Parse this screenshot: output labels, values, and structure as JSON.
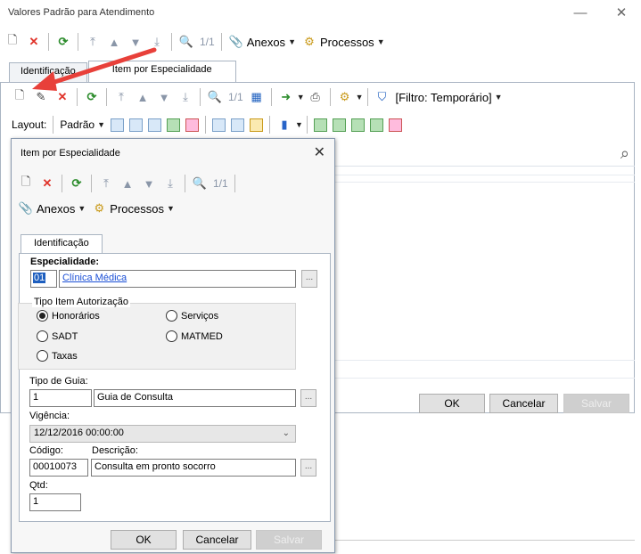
{
  "window": {
    "title": "Valores Padrão para Atendimento",
    "minimize": "—",
    "close": "✕"
  },
  "main_toolbar": {
    "counter": "1/1",
    "anexos": "Anexos",
    "processos": "Processos"
  },
  "main_tabs": [
    {
      "label": "Identificação"
    },
    {
      "label": "Item por Especialidade"
    }
  ],
  "inner_toolbar": {
    "counter": "1/1",
    "filter": "[Filtro: Temporário]"
  },
  "layout_bar": {
    "layout_label": "Layout:",
    "padrao": "Padrão"
  },
  "bg_buttons": {
    "ok": "OK",
    "cancel": "Cancelar",
    "save": "Salvar"
  },
  "dialog": {
    "title": "Item por Especialidade",
    "close": "✕",
    "counter": "1/1",
    "anexos": "Anexos",
    "processos": "Processos",
    "tab": "Identificação",
    "especialidade_label": "Especialidade:",
    "especialidade_code": "01",
    "especialidade_name": "Clínica Médica",
    "group_title": "Tipo Item Autorização",
    "radios": [
      {
        "label": "Honorários",
        "checked": true
      },
      {
        "label": "Serviços",
        "checked": false
      },
      {
        "label": "SADT",
        "checked": false
      },
      {
        "label": "MATMED",
        "checked": false
      },
      {
        "label": "Taxas",
        "checked": false
      }
    ],
    "tipo_guia_label": "Tipo de Guia:",
    "tipo_guia_code": "1",
    "tipo_guia_name": "Guia de Consulta",
    "vigencia_label": "Vigência:",
    "vigencia_value": "12/12/2016 00:00:00",
    "codigo_label": "Código:",
    "descricao_label": "Descrição:",
    "codigo_value": "00010073",
    "descricao_value": "Consulta em pronto socorro",
    "qtd_label": "Qtd:",
    "qtd_value": "1",
    "ok": "OK",
    "cancel": "Cancelar",
    "save": "Salvar",
    "ellipsis": "..."
  },
  "colors": {
    "arrow": "#e8403a",
    "link": "#1a4fd6",
    "selection": "#1e5fbf"
  }
}
